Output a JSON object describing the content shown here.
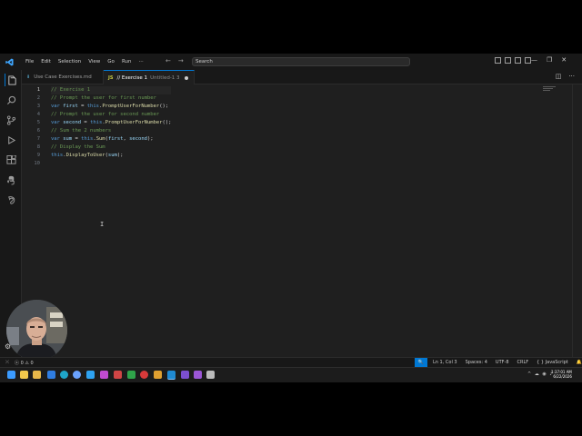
{
  "menu": [
    "File",
    "Edit",
    "Selection",
    "View",
    "Go",
    "Run"
  ],
  "search": {
    "placeholder": "Search"
  },
  "tabs": [
    {
      "label": "Use Case Exercises.md",
      "icon": "markdown-icon"
    },
    {
      "label": "// Exercise 1",
      "sublabel": "Untitled-1 3",
      "icon": "javascript-icon",
      "dirty": true
    }
  ],
  "editor": {
    "line_numbers": [
      "1",
      "2",
      "3",
      "4",
      "5",
      "6",
      "7",
      "8",
      "9",
      "10"
    ],
    "lines": [
      [
        {
          "t": "// Exercise 1",
          "c": "cmt"
        }
      ],
      [
        {
          "t": "// Prompt the user for first number",
          "c": "cmt"
        }
      ],
      [
        {
          "t": "var ",
          "c": "kw"
        },
        {
          "t": "first",
          "c": "var"
        },
        {
          "t": " = ",
          "c": "pl"
        },
        {
          "t": "this",
          "c": "kw"
        },
        {
          "t": ".",
          "c": "pl"
        },
        {
          "t": "PromptUserForNumber",
          "c": "fn"
        },
        {
          "t": "();",
          "c": "pl"
        }
      ],
      [
        {
          "t": "// Prompt the user for second number",
          "c": "cmt"
        }
      ],
      [
        {
          "t": "var ",
          "c": "kw"
        },
        {
          "t": "second",
          "c": "var"
        },
        {
          "t": " = ",
          "c": "pl"
        },
        {
          "t": "this",
          "c": "kw"
        },
        {
          "t": ".",
          "c": "pl"
        },
        {
          "t": "PromptUserForNumber",
          "c": "fn"
        },
        {
          "t": "();",
          "c": "pl"
        }
      ],
      [
        {
          "t": "// Sum the 2 numbers",
          "c": "cmt"
        }
      ],
      [
        {
          "t": "var ",
          "c": "kw"
        },
        {
          "t": "sum",
          "c": "var"
        },
        {
          "t": " = ",
          "c": "pl"
        },
        {
          "t": "this",
          "c": "kw"
        },
        {
          "t": ".",
          "c": "pl"
        },
        {
          "t": "Sum",
          "c": "fn"
        },
        {
          "t": "(",
          "c": "pl"
        },
        {
          "t": "first",
          "c": "var"
        },
        {
          "t": ", ",
          "c": "pl"
        },
        {
          "t": "second",
          "c": "var"
        },
        {
          "t": ");",
          "c": "pl"
        }
      ],
      [
        {
          "t": "// Display the Sum",
          "c": "cmt"
        }
      ],
      [
        {
          "t": "this",
          "c": "kw"
        },
        {
          "t": ".",
          "c": "pl"
        },
        {
          "t": "DisplayToUser",
          "c": "fn"
        },
        {
          "t": "(",
          "c": "pl"
        },
        {
          "t": "sum",
          "c": "var"
        },
        {
          "t": ");",
          "c": "pl"
        }
      ],
      []
    ],
    "current_line": 1
  },
  "status": {
    "errors": "0",
    "warnings": "0",
    "position": "Ln 1, Col 3",
    "spaces": "Spaces: 4",
    "encoding": "UTF-8",
    "eol": "CRLF",
    "language": "JavaScript"
  },
  "clock": {
    "time": "1:37:01 AM",
    "date": "6/22/2026"
  },
  "colors": {
    "accent": "#0078d4",
    "background": "#1f1f1f",
    "comment": "#6a9955",
    "keyword": "#569cd6"
  }
}
